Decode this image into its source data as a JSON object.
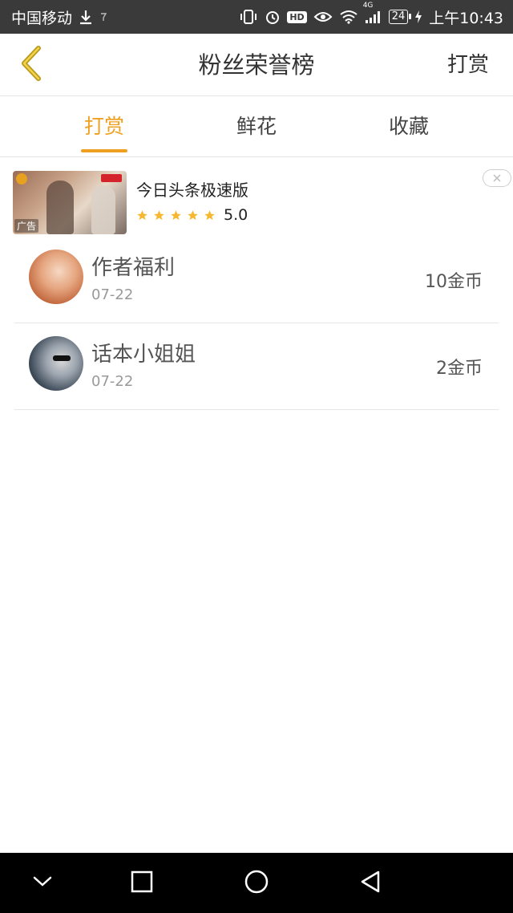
{
  "status_bar": {
    "carrier": "中国移动",
    "network": "4G",
    "hd_label": "HD",
    "battery": "24",
    "time": "上午10:43"
  },
  "header": {
    "title": "粉丝荣誉榜",
    "action_label": "打赏"
  },
  "tabs": [
    {
      "label": "打赏",
      "active": true
    },
    {
      "label": "鲜花",
      "active": false
    },
    {
      "label": "收藏",
      "active": false
    }
  ],
  "ad": {
    "title": "今日头条极速版",
    "rating": "5.0",
    "stars": 5,
    "tag": "广告"
  },
  "rewards": [
    {
      "name": "作者福利",
      "date": "07-22",
      "amount": "10金币"
    },
    {
      "name": "话本小姐姐",
      "date": "07-22",
      "amount": "2金币"
    }
  ],
  "colors": {
    "accent": "#f0a020",
    "status_bar_bg": "#3a3a3a",
    "nav_bar_bg": "#000000",
    "star": "#f5b82e"
  }
}
